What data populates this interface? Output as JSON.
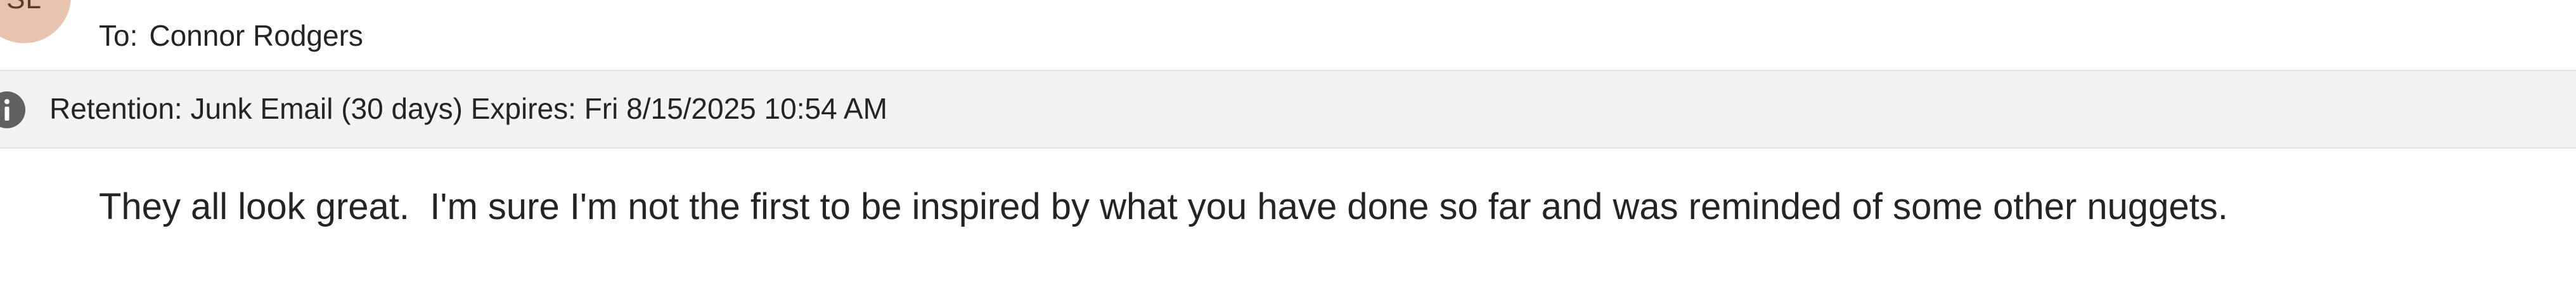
{
  "sender": {
    "avatar_initials": "SL",
    "avatar_color": "#e8c3b0"
  },
  "header": {
    "to_label": "To:",
    "to_recipient": "Connor Rodgers"
  },
  "retention": {
    "icon": "info-icon",
    "text": "Retention: Junk Email (30 days) Expires: Fri 8/15/2025 10:54 AM"
  },
  "message": {
    "body": "They all look great.  I'm sure I'm not the first to be inspired by what you have done so far and was reminded of some other nuggets."
  }
}
